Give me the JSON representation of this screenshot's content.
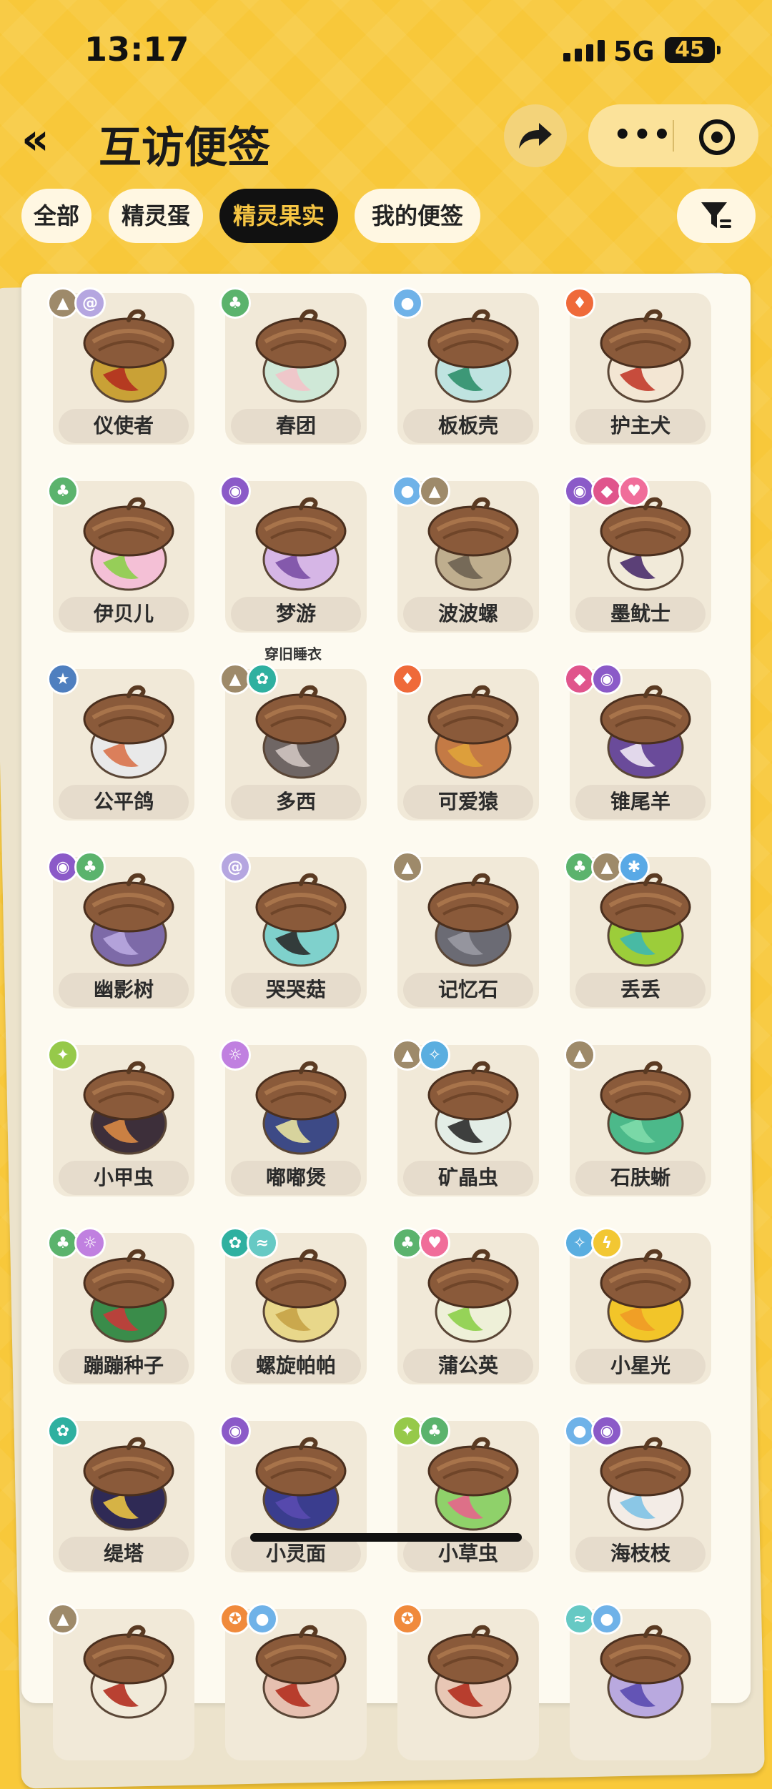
{
  "status_bar": {
    "time": "13:17",
    "network": "5G",
    "battery": "45"
  },
  "nav": {
    "back_label": "«",
    "title": "互访便签"
  },
  "tabs": [
    {
      "label": "全部",
      "active": false
    },
    {
      "label": "精灵蛋",
      "active": false
    },
    {
      "label": "精灵果实",
      "active": true
    },
    {
      "label": "我的便签",
      "active": false
    }
  ],
  "colors": {
    "background": "#f8c83a",
    "active_tab": "#111111",
    "active_tab_text": "#f6c543",
    "stone": "#9e8a6a",
    "fantasy": "#b5a6e0",
    "grass": "#5bb36d",
    "water": "#6fb2e8",
    "fire": "#ef6a3a",
    "ghost": "#8b5ac8",
    "demon": "#e0558c",
    "cute": "#f06d9a",
    "normal": "#4f7fbf",
    "mech": "#2fb0a0",
    "bug": "#96c94a",
    "light": "#5aaee0",
    "electric": "#f2c733",
    "wing": "#66c9c4",
    "ice": "#59a9e6",
    "poison": "#c080e0",
    "martial": "#f08a3c"
  },
  "items": [
    {
      "name": "仪使者",
      "icons": [
        "stone-icon",
        "fantasy-icon"
      ],
      "colors": [
        "#c9a136",
        "#b22f1f"
      ]
    },
    {
      "name": "春团",
      "icons": [
        "grass-icon"
      ],
      "colors": [
        "#cfe8d7",
        "#f2c3c9"
      ]
    },
    {
      "name": "板板壳",
      "icons": [
        "water-icon"
      ],
      "colors": [
        "#bfe3e0",
        "#2f8f6c"
      ]
    },
    {
      "name": "护主犬",
      "icons": [
        "fire-icon"
      ],
      "colors": [
        "#f3e6d3",
        "#c23b2b"
      ]
    },
    {
      "name": "伊贝儿",
      "icons": [
        "grass-icon"
      ],
      "colors": [
        "#f4c0d6",
        "#8ccf4a"
      ]
    },
    {
      "name": "梦游",
      "icons": [
        "ghost-icon"
      ],
      "colors": [
        "#d6b6e6",
        "#7b4fa5"
      ]
    },
    {
      "name": "波波螺",
      "icons": [
        "water-icon",
        "stone-icon"
      ],
      "colors": [
        "#bfae8e",
        "#6e6352"
      ]
    },
    {
      "name": "墨鱿士",
      "icons": [
        "ghost-icon",
        "demon-icon",
        "cute-icon"
      ],
      "colors": [
        "#f1ead9",
        "#4a2d6b"
      ]
    },
    {
      "name": "公平鸽",
      "icons": [
        "normal-icon"
      ],
      "colors": [
        "#e9e9e9",
        "#d9734b"
      ]
    },
    {
      "name": "多西",
      "icons": [
        "stone-icon",
        "mech-icon"
      ],
      "colors": [
        "#6f6664",
        "#cfc4c0"
      ]
    },
    {
      "name": "可爱猿",
      "icons": [
        "fire-icon"
      ],
      "colors": [
        "#c47a45",
        "#e0a33a"
      ]
    },
    {
      "name": "锥尾羊",
      "icons": [
        "demon-icon",
        "ghost-icon"
      ],
      "colors": [
        "#6a4b9a",
        "#efe8f4"
      ]
    },
    {
      "name": "幽影树",
      "icons": [
        "ghost-icon",
        "grass-icon"
      ],
      "colors": [
        "#7d6aa8",
        "#b9a9df"
      ]
    },
    {
      "name": "哭哭菇",
      "icons": [
        "fantasy-icon"
      ],
      "colors": [
        "#7fd1cc",
        "#2b2b2b"
      ]
    },
    {
      "name": "记忆石",
      "icons": [
        "stone-icon"
      ],
      "colors": [
        "#6b6b74",
        "#9a9aa3"
      ]
    },
    {
      "name": "丢丢",
      "icons": [
        "grass-icon",
        "stone-icon",
        "ice-icon"
      ],
      "colors": [
        "#9ccd3a",
        "#3fb8b0"
      ]
    },
    {
      "name": "小甲虫",
      "icons": [
        "bug-icon"
      ],
      "colors": [
        "#3d2f3a",
        "#d98a45"
      ]
    },
    {
      "name": "嘟嘟煲",
      "icons": [
        "poison-icon"
      ],
      "colors": [
        "#3d4a86",
        "#e8e2a0"
      ]
    },
    {
      "name": "矿晶虫",
      "icons": [
        "stone-icon",
        "light-icon"
      ],
      "colors": [
        "#e3ede6",
        "#2b2b2b"
      ]
    },
    {
      "name": "石肤蜥",
      "icons": [
        "stone-icon"
      ],
      "colors": [
        "#4cb98a",
        "#7fdcaa"
      ]
    },
    {
      "name": "蹦蹦种子",
      "icons": [
        "grass-icon",
        "poison-icon"
      ],
      "colors": [
        "#3a8c4a",
        "#c73a3a"
      ]
    },
    {
      "name": "螺旋帕帕",
      "icons": [
        "mech-icon",
        "wing-icon"
      ],
      "colors": [
        "#e8d78a",
        "#c6a346"
      ]
    },
    {
      "name": "蒲公英",
      "icons": [
        "grass-icon",
        "cute-icon"
      ],
      "colors": [
        "#eef0d8",
        "#8ccf4a"
      ]
    },
    {
      "name": "小星光",
      "icons": [
        "light-icon",
        "electric-icon"
      ],
      "colors": [
        "#f2c529",
        "#f09a26"
      ]
    },
    {
      "name": "缇塔",
      "icons": [
        "mech-icon"
      ],
      "colors": [
        "#2f2a55",
        "#e9c244"
      ]
    },
    {
      "name": "小灵面",
      "icons": [
        "ghost-icon"
      ],
      "colors": [
        "#3a3d8e",
        "#5a4ab0"
      ]
    },
    {
      "name": "小草虫",
      "icons": [
        "bug-icon",
        "grass-icon"
      ],
      "colors": [
        "#8fd16a",
        "#e5658c"
      ]
    },
    {
      "name": "海枝枝",
      "icons": [
        "water-icon",
        "ghost-icon"
      ],
      "colors": [
        "#f3ece6",
        "#7fc3e6"
      ]
    },
    {
      "name": "",
      "icons": [
        "stone-icon"
      ],
      "colors": [
        "#f1ead9",
        "#b22f1f"
      ]
    },
    {
      "name": "",
      "icons": [
        "martial-icon",
        "water-icon"
      ],
      "colors": [
        "#e6c0b0",
        "#b22f1f"
      ]
    },
    {
      "name": "",
      "icons": [
        "martial-icon"
      ],
      "colors": [
        "#e8c7b5",
        "#b22f1f"
      ]
    },
    {
      "name": "",
      "icons": [
        "wing-icon",
        "water-icon"
      ],
      "colors": [
        "#b9a9df",
        "#5a4ab0"
      ]
    }
  ],
  "notes": [
    {
      "text": "穿旧睡衣"
    }
  ]
}
